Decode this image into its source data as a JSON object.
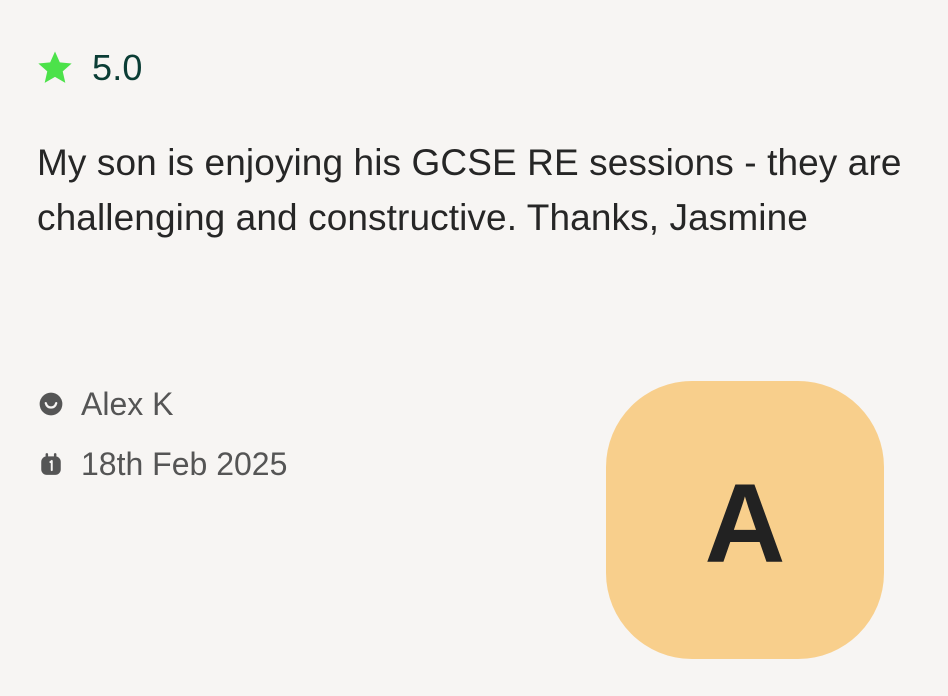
{
  "review": {
    "rating": "5.0",
    "text": "My son is enjoying his GCSE RE sessions - they are challenging and constructive. Thanks, Jasmine",
    "author": "Alex K",
    "date": "18th Feb 2025",
    "avatar_initial": "A"
  },
  "icons": {
    "rating": "star-icon",
    "author": "smiley-icon",
    "date": "calendar-icon"
  },
  "colors": {
    "star": "#4ce24a",
    "rating_text": "#0b3d35",
    "avatar_background": "#f8cf8c",
    "body_text": "#262626",
    "meta_text": "#555555"
  }
}
